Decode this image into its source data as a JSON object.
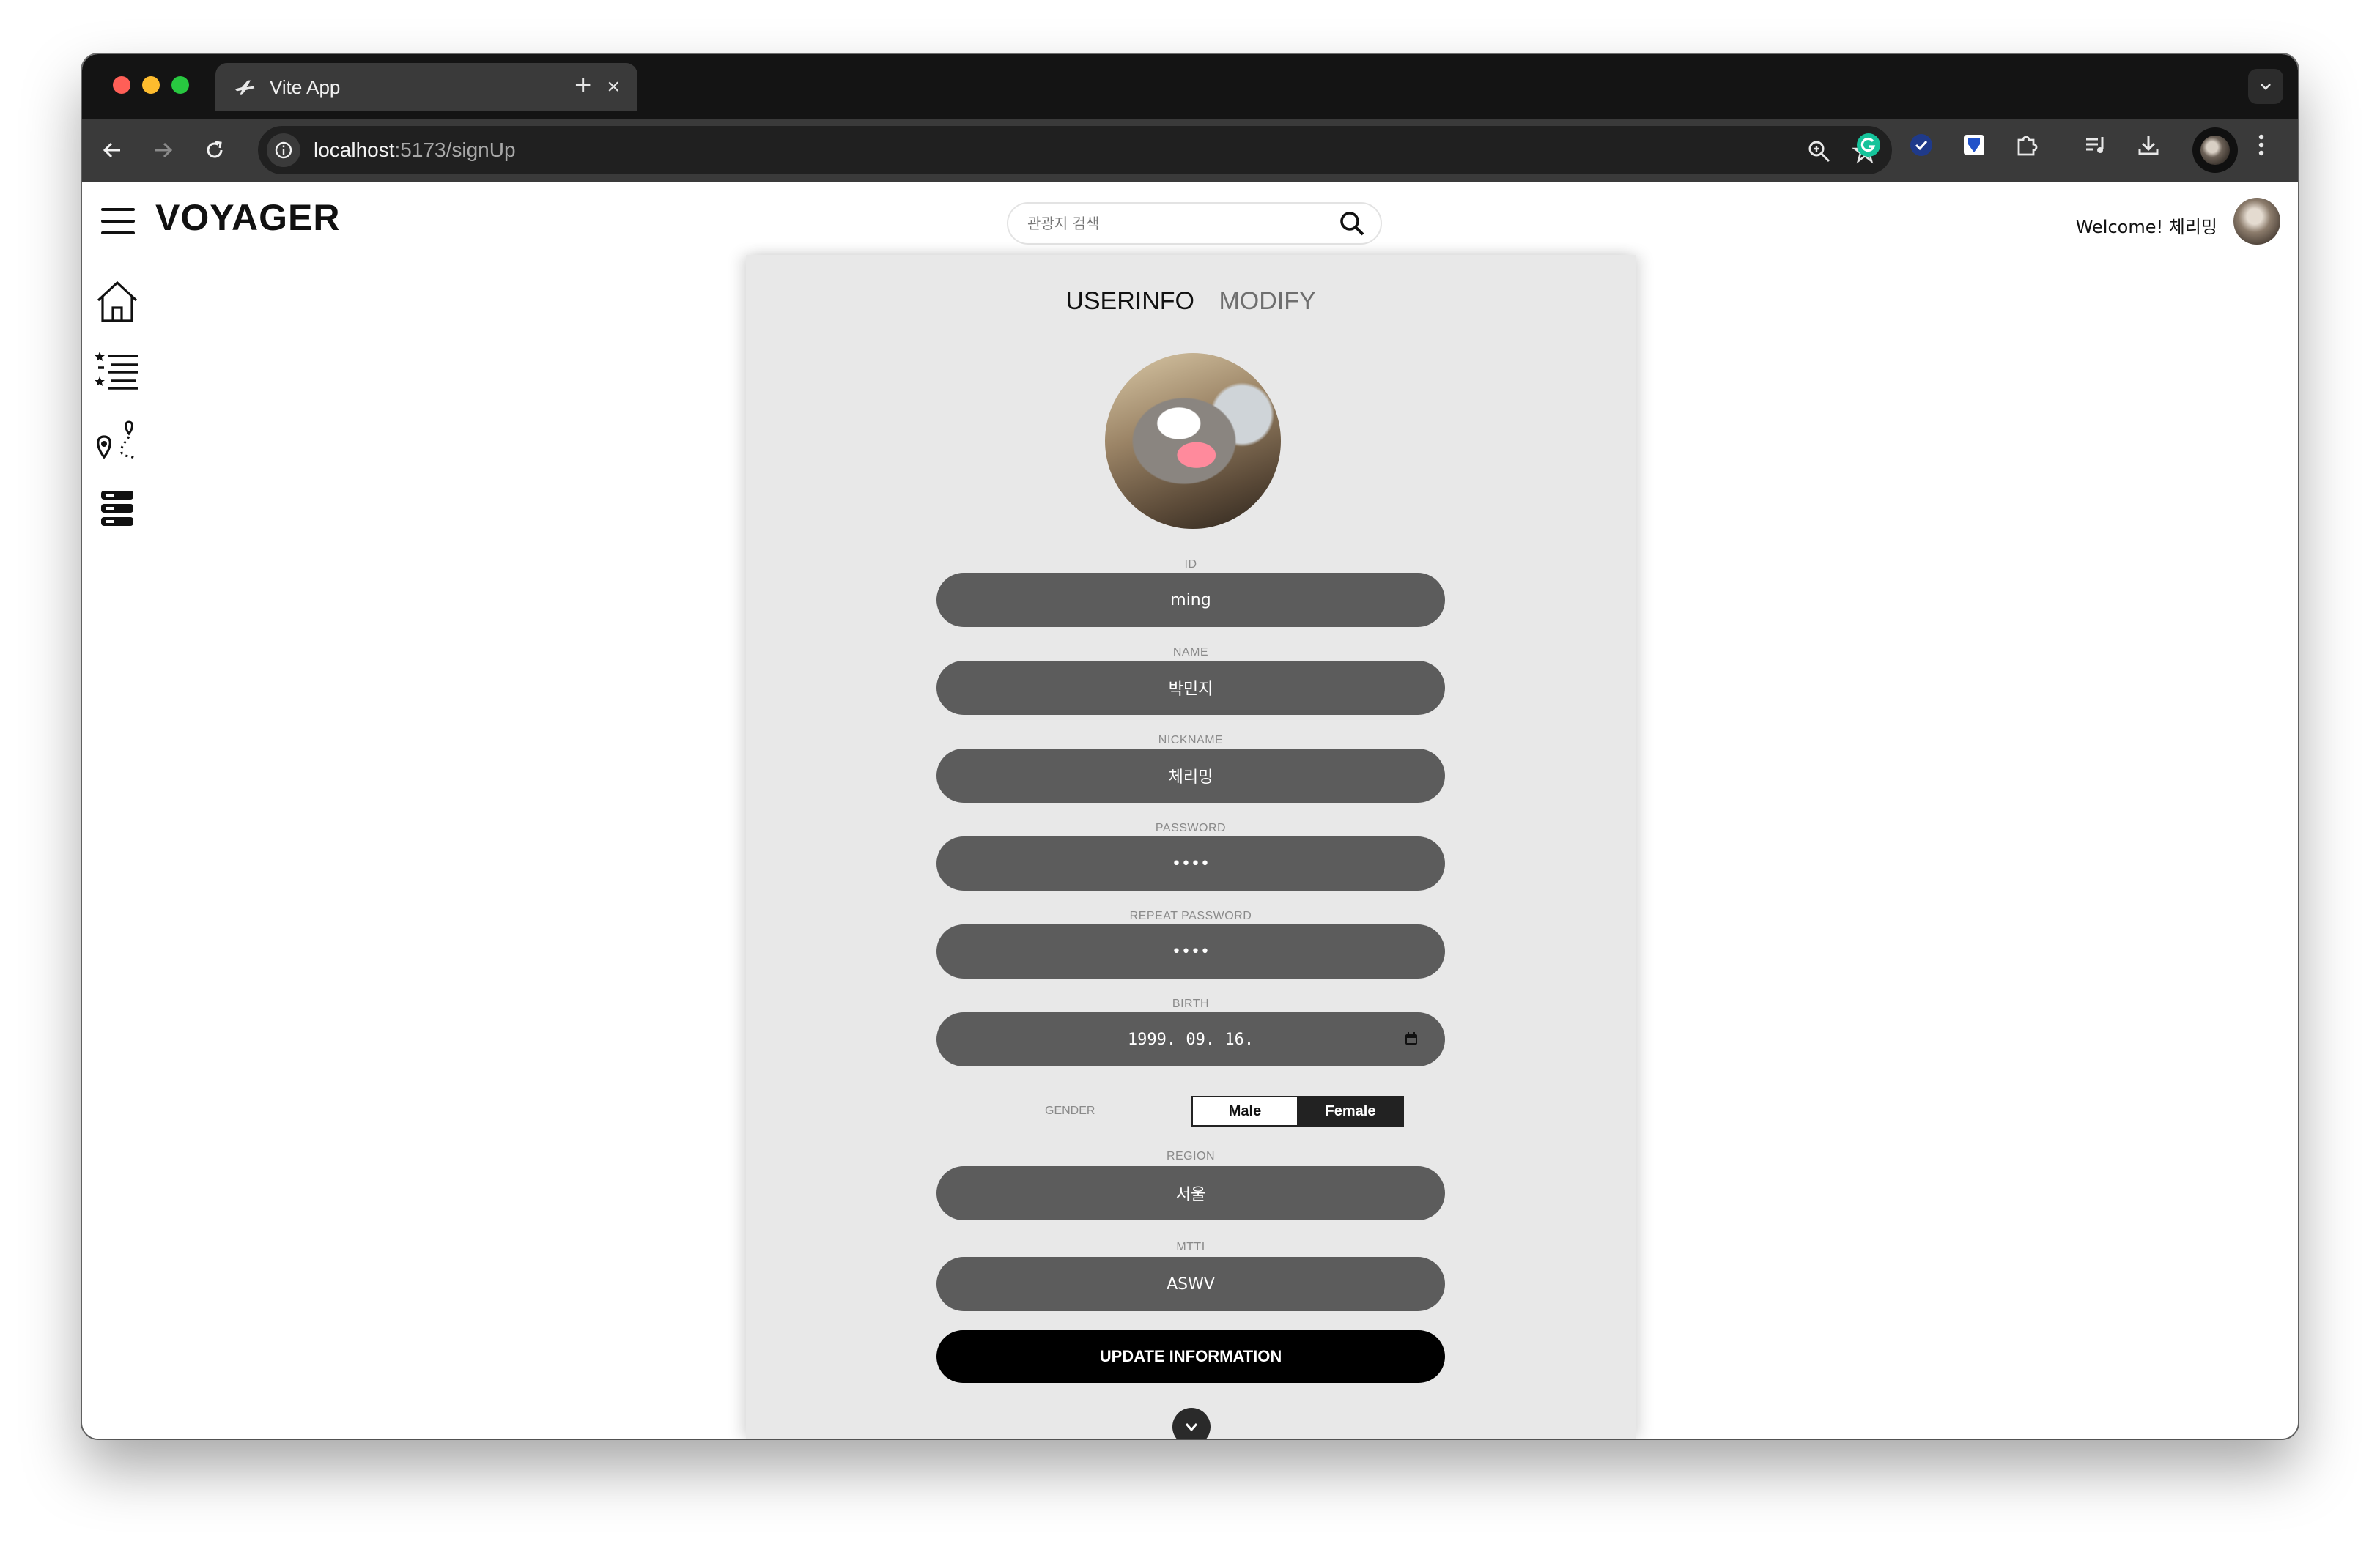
{
  "browser": {
    "tab_title": "Vite App",
    "tab_close": "×",
    "new_tab": "+",
    "url_host": "localhost",
    "url_path": ":5173/signUp"
  },
  "header": {
    "logo": "VOYAGER",
    "search_placeholder": "관광지 검색",
    "welcome": "Welcome! 체리밍"
  },
  "form": {
    "tabs": [
      {
        "label": "USERINFO",
        "active": true
      },
      {
        "label": "MODIFY",
        "active": false
      }
    ],
    "fields": [
      {
        "label": "ID",
        "value": "ming"
      },
      {
        "label": "NAME",
        "value": "박민지"
      },
      {
        "label": "NICKNAME",
        "value": "체리밍"
      },
      {
        "label": "PASSWORD",
        "value": "••••"
      },
      {
        "label": "REPEAT PASSWORD",
        "value": "••••"
      },
      {
        "label": "BIRTH",
        "value": "1999. 09. 16."
      }
    ],
    "gender": {
      "label": "GENDER",
      "options": [
        "Male",
        "Female"
      ],
      "selected": "Female"
    },
    "region": {
      "label": "REGION",
      "value": "서울"
    },
    "mtti": {
      "label": "MTTI",
      "value": "ASWV"
    },
    "submit_label": "UPDATE INFORMATION"
  },
  "colors": {
    "field_bg": "#5c5c5c",
    "panel_bg": "#e8e8e8",
    "submit_bg": "#000000",
    "chrome_dark": "#141414"
  },
  "icons": {
    "sidebar": [
      "home-icon",
      "ranked-list-icon",
      "route-map-icon",
      "server-stack-icon"
    ]
  }
}
